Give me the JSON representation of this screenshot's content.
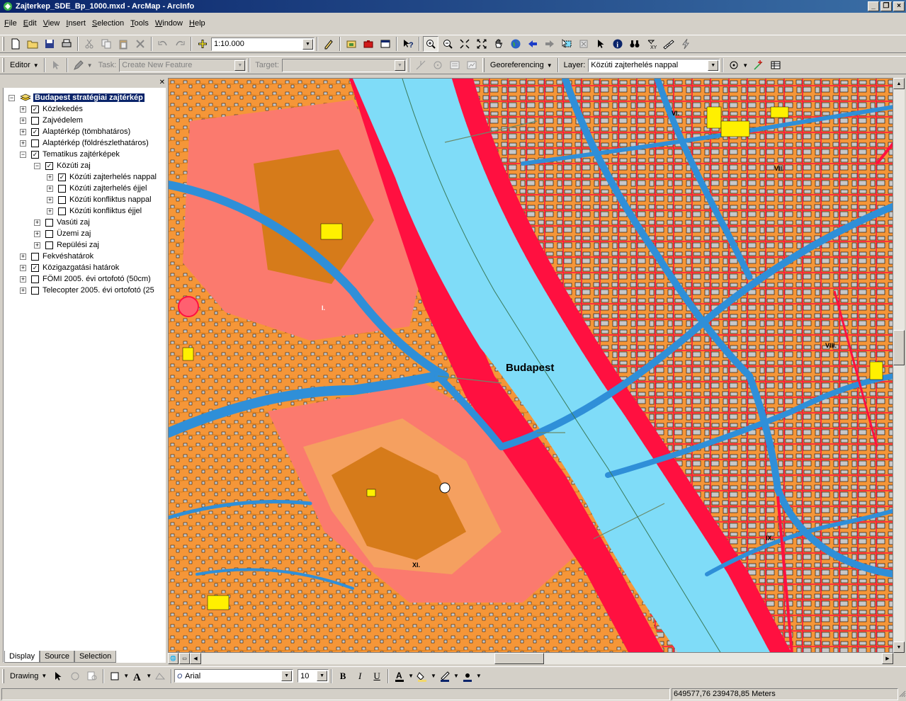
{
  "window": {
    "title": "Zajterkep_SDE_Bp_1000.mxd - ArcMap - ArcInfo",
    "minimize": "_",
    "restore": "❐",
    "close": "×"
  },
  "menu": [
    "File",
    "Edit",
    "View",
    "Insert",
    "Selection",
    "Tools",
    "Window",
    "Help"
  ],
  "standard_toolbar": {
    "scale": "1:10.000"
  },
  "editor_toolbar": {
    "editor_label": "Editor",
    "task_label": "Task:",
    "task_value": "Create New Feature",
    "target_label": "Target:",
    "target_value": "",
    "georef_label": "Georeferencing",
    "layer_label": "Layer:",
    "layer_value": "Közúti zajterhelés nappal"
  },
  "toc": {
    "root": "Budapest stratégiai zajtérkép",
    "items": [
      {
        "label": "Közlekedés",
        "checked": true,
        "indent": 1,
        "exp": "+"
      },
      {
        "label": "Zajvédelem",
        "checked": false,
        "indent": 1,
        "exp": "+"
      },
      {
        "label": "Alaptérkép (tömbhatáros)",
        "checked": true,
        "indent": 1,
        "exp": "+"
      },
      {
        "label": "Alaptérkép (földrészlethatáros)",
        "checked": false,
        "indent": 1,
        "exp": "+"
      },
      {
        "label": "Tematikus zajtérképek",
        "checked": true,
        "indent": 1,
        "exp": "−"
      },
      {
        "label": "Közúti zaj",
        "checked": true,
        "indent": 2,
        "exp": "−"
      },
      {
        "label": "Közúti zajterhelés nappal",
        "checked": true,
        "indent": 3,
        "exp": "+"
      },
      {
        "label": "Közúti zajterhelés éjjel",
        "checked": false,
        "indent": 3,
        "exp": "+"
      },
      {
        "label": "Közúti konfliktus nappal",
        "checked": false,
        "indent": 3,
        "exp": "+"
      },
      {
        "label": "Közúti konfliktus éjjel",
        "checked": false,
        "indent": 3,
        "exp": "+"
      },
      {
        "label": "Vasúti zaj",
        "checked": false,
        "indent": 2,
        "exp": "+"
      },
      {
        "label": "Üzemi zaj",
        "checked": false,
        "indent": 2,
        "exp": "+"
      },
      {
        "label": "Repülési zaj",
        "checked": false,
        "indent": 2,
        "exp": "+"
      },
      {
        "label": "Fekvéshatárok",
        "checked": false,
        "indent": 1,
        "exp": "+"
      },
      {
        "label": "Közigazgatási határok",
        "checked": true,
        "indent": 1,
        "exp": "+"
      },
      {
        "label": "FÖMI 2005. évi ortofotó (50cm)",
        "checked": false,
        "indent": 1,
        "exp": "+"
      },
      {
        "label": "Telecopter 2005. évi ortofotó (25",
        "checked": false,
        "indent": 1,
        "exp": "+"
      }
    ],
    "tabs": [
      "Display",
      "Source",
      "Selection"
    ]
  },
  "map": {
    "city_label": "Budapest",
    "district_labels": [
      "I.",
      "VI.",
      "VII.",
      "VIII.",
      "IX.",
      "XI."
    ],
    "colors": {
      "river": "#7fdcf8",
      "road": "#2f8fd8",
      "high": "#ff1040",
      "medhigh": "#fb7a6e",
      "med": "#f59638",
      "low": "#d67b1a",
      "building": "#c8c8c8",
      "highlight": "#fff000"
    }
  },
  "drawing_toolbar": {
    "drawing_label": "Drawing",
    "font": "Arial",
    "size": "10"
  },
  "status": {
    "coords": "649577,76  239478,85 Meters"
  }
}
